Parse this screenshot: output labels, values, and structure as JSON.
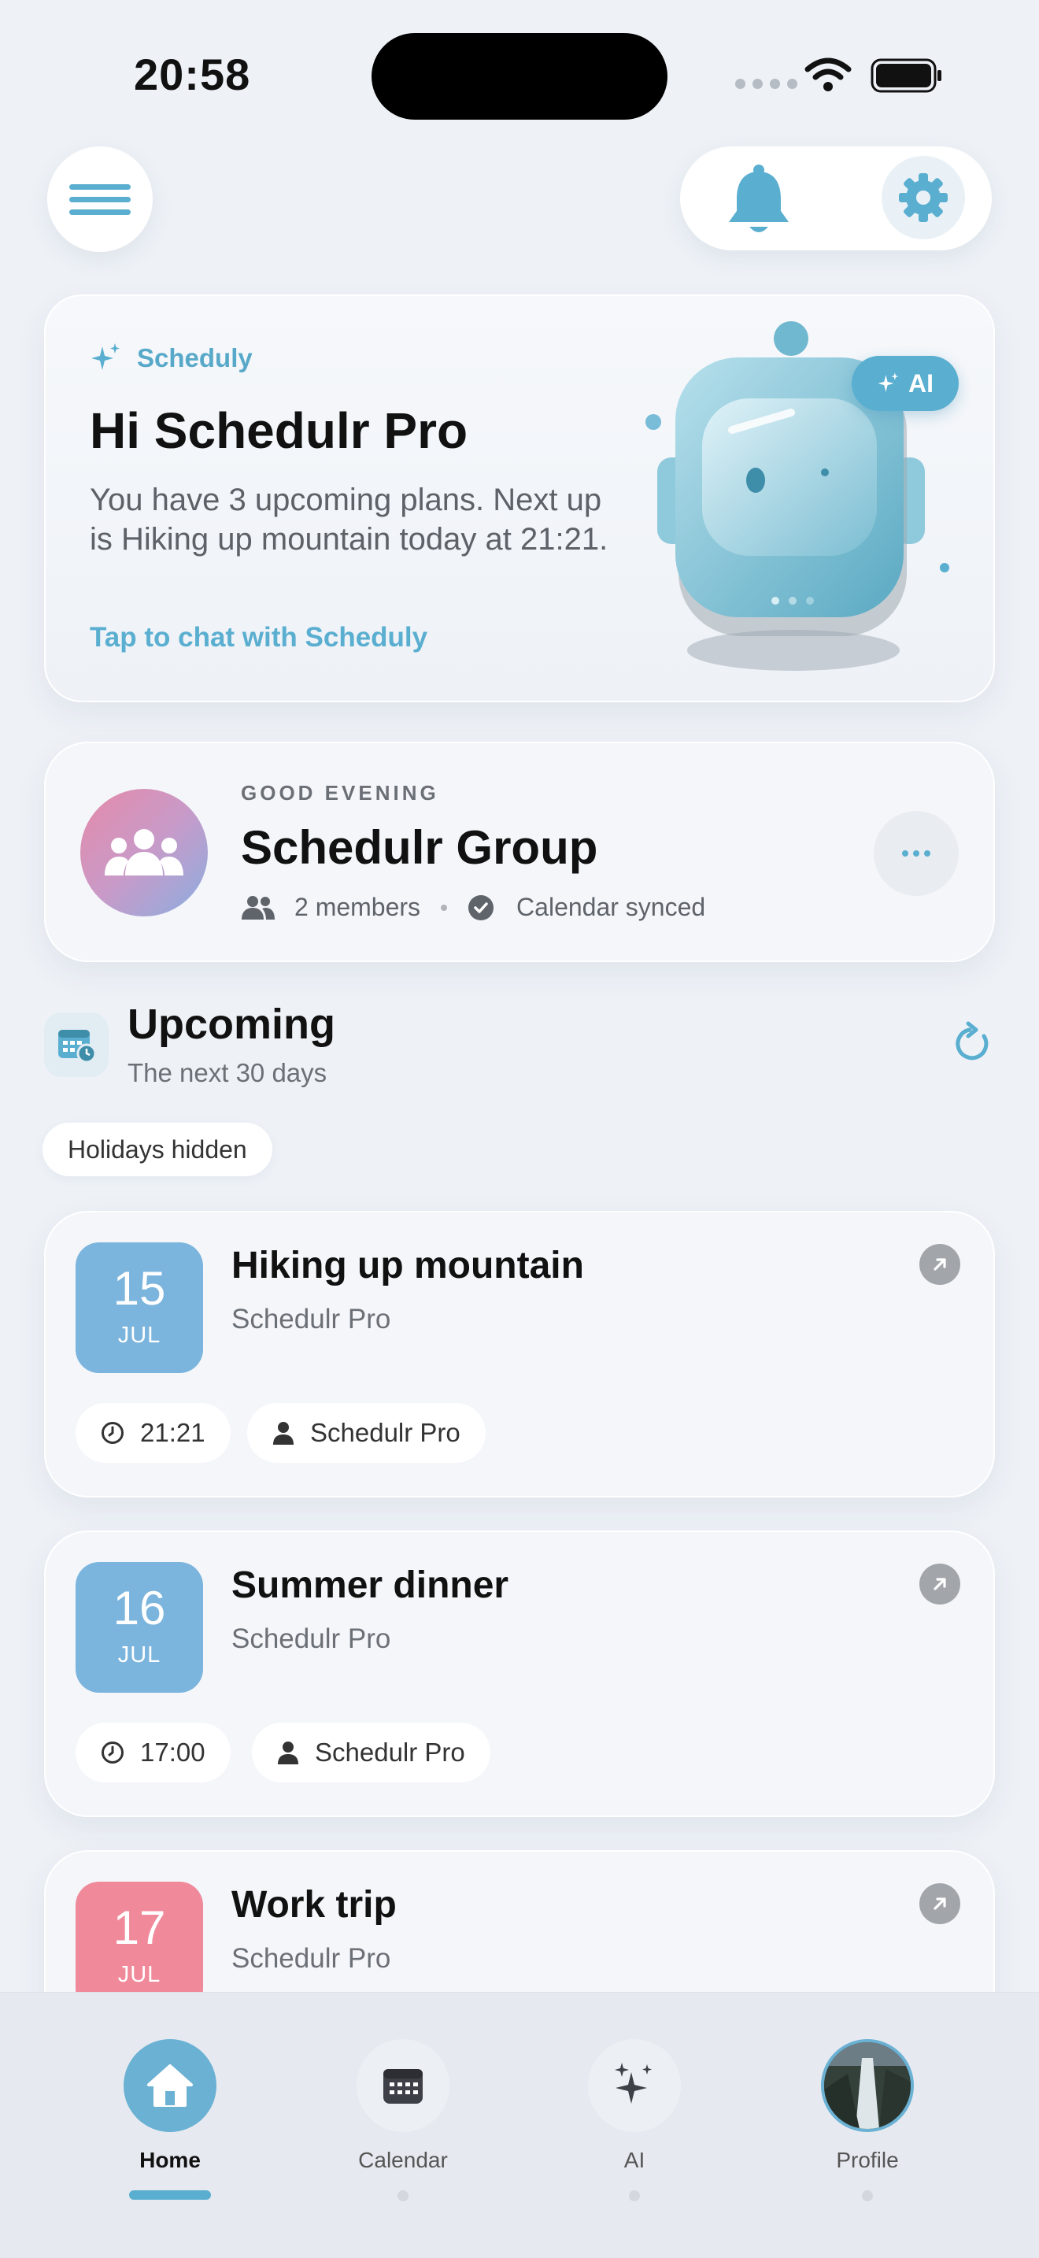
{
  "status": {
    "time": "20:58"
  },
  "assistant": {
    "brand": "Scheduly",
    "title": "Hi Schedulr Pro",
    "description": "You have 3 upcoming plans. Next up is Hiking up mountain today at 21:21.",
    "link": "Tap to chat with Scheduly",
    "badge": "AI"
  },
  "group": {
    "greeting": "GOOD EVENING",
    "name": "Schedulr Group",
    "members": "2 members",
    "sync": "Calendar synced"
  },
  "upcoming": {
    "title": "Upcoming",
    "subtitle": "The next 30 days",
    "filter_chip": "Holidays hidden"
  },
  "events": [
    {
      "day": "15",
      "month": "JUL",
      "title": "Hiking up mountain",
      "owner": "Schedulr Pro",
      "time": "21:21",
      "person": "Schedulr Pro",
      "color": "#7bb4dc"
    },
    {
      "day": "16",
      "month": "JUL",
      "title": "Summer dinner",
      "owner": "Schedulr Pro",
      "time": "17:00",
      "person": "Schedulr Pro",
      "color": "#7bb4dc"
    },
    {
      "day": "17",
      "month": "JUL",
      "title": "Work trip",
      "owner": "Schedulr Pro",
      "color": "#f08a9b"
    }
  ],
  "tabs": [
    {
      "label": "Home",
      "icon": "home-icon",
      "active": true
    },
    {
      "label": "Calendar",
      "icon": "calendar-icon",
      "active": false
    },
    {
      "label": "AI",
      "icon": "sparkle-icon",
      "active": false
    },
    {
      "label": "Profile",
      "icon": "avatar",
      "active": false
    }
  ],
  "colors": {
    "accent": "#5aaed0",
    "background": "#eef2f7"
  }
}
